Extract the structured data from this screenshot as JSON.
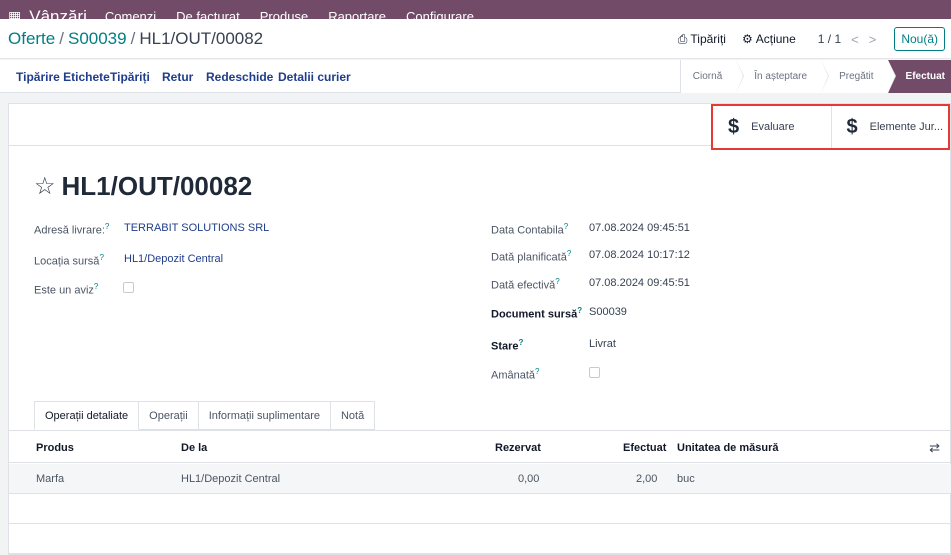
{
  "navbar": {
    "apps_icon": "apps-grid-icon",
    "brand": "Vânzări",
    "menu": [
      "Comenzi",
      "De facturat",
      "Produse",
      "Raportare",
      "Configurare"
    ]
  },
  "breadcrumb": {
    "parent1": "Oferte",
    "parent2": "S00039",
    "current": "HL1/OUT/00082"
  },
  "control": {
    "print_label": "Tipăriți",
    "action_label": "Acțiune",
    "pager": "1 / 1",
    "new_label": "Nou(ă)"
  },
  "actions": {
    "print_labels": "Tipărire Etichete",
    "print": "Tipăriți",
    "return": "Retur",
    "reopen": "Redeschide",
    "courier": "Detalii curier"
  },
  "statusbar": {
    "stages": [
      "Ciornă",
      "În așteptare",
      "Pregătit",
      "Efectuat"
    ],
    "active": "Efectuat"
  },
  "smart_buttons": {
    "valuation": "Evaluare",
    "journal": "Elemente Jur..."
  },
  "form": {
    "title": "HL1/OUT/00082",
    "left": {
      "delivery_label": "Adresă livrare:",
      "delivery_value": "TERRABIT SOLUTIONS SRL",
      "source_loc_label": "Locația sursă",
      "source_loc_value": "HL1/Depozit Central",
      "is_notice_label": "Este un aviz"
    },
    "right": {
      "accounting_date_label": "Data Contabila",
      "accounting_date_value": "07.08.2024 09:45:51",
      "planned_date_label": "Dată planificată",
      "planned_date_value": "07.08.2024 10:17:12",
      "effective_date_label": "Dată efectivă",
      "effective_date_value": "07.08.2024 09:45:51",
      "source_doc_label": "Document sursă",
      "source_doc_value": "S00039",
      "state_label": "Stare",
      "state_value": "Livrat",
      "postponed_label": "Amânată"
    },
    "help_mark": "?"
  },
  "tabs": [
    "Operații detaliate",
    "Operații",
    "Informații suplimentare",
    "Notă"
  ],
  "table": {
    "headers": {
      "product": "Produs",
      "from": "De la",
      "reserved": "Rezervat",
      "done": "Efectuat",
      "uom": "Unitatea de măsură"
    },
    "rows": [
      {
        "product": "Marfa",
        "from": "HL1/Depozit Central",
        "reserved": "0,00",
        "done": "2,00",
        "uom": "buc"
      }
    ]
  },
  "colors": {
    "brand": "#714b67",
    "link": "#1f3d8a",
    "teal": "#017e84",
    "highlight": "#e53935"
  }
}
